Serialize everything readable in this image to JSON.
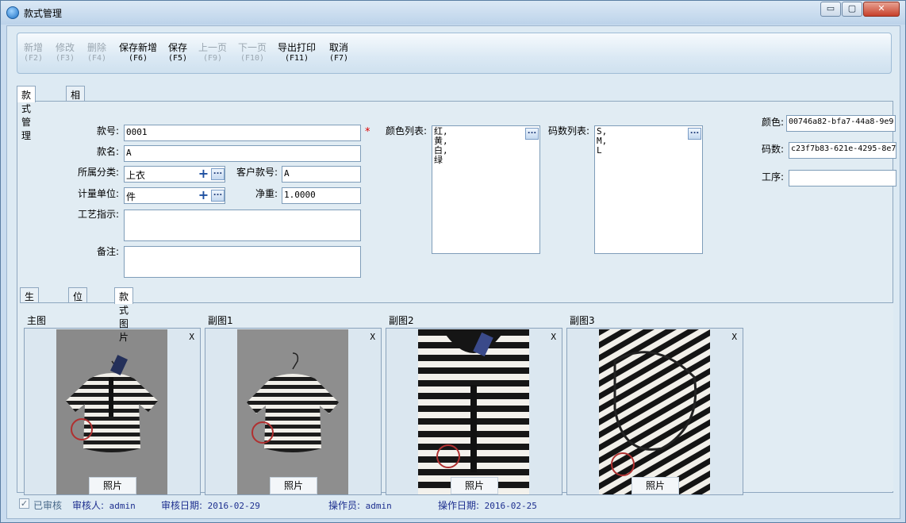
{
  "window": {
    "title": "款式管理",
    "min_glyph": "▭",
    "max_glyph": "▢",
    "close_glyph": "✕"
  },
  "toolbar": {
    "buttons": [
      {
        "label": "新增",
        "key": "(F2)",
        "enabled": false
      },
      {
        "label": "修改",
        "key": "(F3)",
        "enabled": false
      },
      {
        "label": "删除",
        "key": "(F4)",
        "enabled": false
      },
      {
        "label": "保存新增",
        "key": "(F6)",
        "enabled": true
      },
      {
        "label": "保存",
        "key": "(F5)",
        "enabled": true
      },
      {
        "label": "上一页",
        "key": "(F9)",
        "enabled": false
      },
      {
        "label": "下一页",
        "key": "(F10)",
        "enabled": false
      },
      {
        "label": "导出打印",
        "key": "(F11)",
        "enabled": true
      },
      {
        "label": "取消",
        "key": "(F7)",
        "enabled": true
      }
    ]
  },
  "main_tabs": [
    "款式管理",
    "相关附件"
  ],
  "form": {
    "style_no_label": "款号:",
    "style_no": "0001",
    "required_mark": "*",
    "style_name_label": "款名:",
    "style_name": "A",
    "category_label": "所属分类:",
    "category": "上衣",
    "customer_no_label": "客户款号:",
    "customer_no": "A",
    "unit_label": "计量单位:",
    "unit": "件",
    "net_weight_label": "净重:",
    "net_weight": "1.0000",
    "craft_label": "工艺指示:",
    "craft": "",
    "remark_label": "备注:",
    "remark": "",
    "color_list_label": "颜色列表:",
    "color_list": [
      "红,",
      "黄,",
      "白,",
      "绿"
    ],
    "size_list_label": "码数列表:",
    "size_list": [
      "S,",
      "M,",
      "L"
    ],
    "color_id_label": "颜色:",
    "color_id": "00746a82-bfa7-44a8-9e9",
    "size_id_label": "码数:",
    "size_id": "c23f7b83-621e-4295-8e7",
    "process_label": "工序:",
    "process": "",
    "plus_glyph": "+",
    "dots_glyph": "..."
  },
  "sub_tabs": [
    "生产工艺",
    "位置尺码",
    "款式图片"
  ],
  "photos": [
    {
      "title": "主图",
      "remove": "X",
      "button": "照片"
    },
    {
      "title": "副图1",
      "remove": "X",
      "button": "照片"
    },
    {
      "title": "副图2",
      "remove": "X",
      "button": "照片"
    },
    {
      "title": "副图3",
      "remove": "X",
      "button": "照片"
    }
  ],
  "status": {
    "checkbox_mark": "✓",
    "approved_label": "已审核",
    "auditor_label": "审核人:",
    "auditor": "admin",
    "audit_date_label": "审核日期:",
    "audit_date": "2016-02-29",
    "operator_label": "操作员:",
    "operator": "admin",
    "op_date_label": "操作日期:",
    "op_date": "2016-02-25"
  },
  "colors": {
    "status_text": "#1d2f8f",
    "required": "#dd0000"
  }
}
